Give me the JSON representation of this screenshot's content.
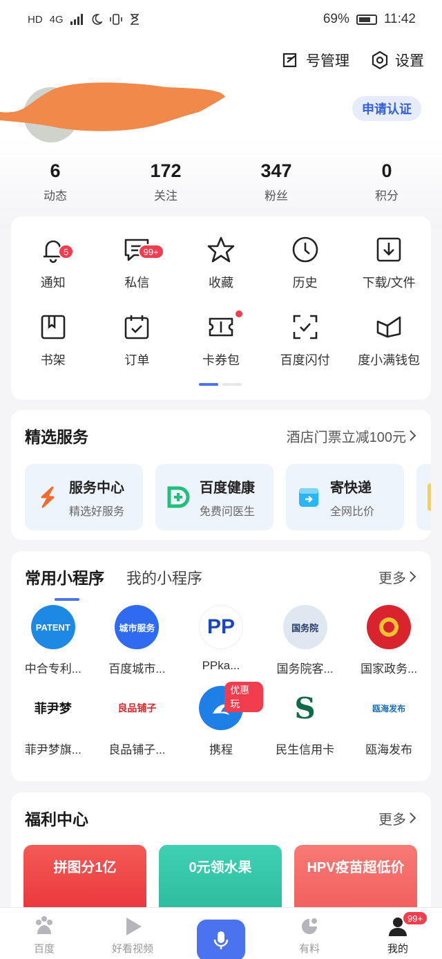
{
  "status_bar": {
    "left_icons": [
      "HD",
      "4G"
    ],
    "battery": "69%",
    "time": "11:42"
  },
  "header": {
    "account_manage": "号管理",
    "settings": "设置"
  },
  "profile": {
    "certify_button": "申请认证"
  },
  "stats": [
    {
      "num": "6",
      "label": "动态"
    },
    {
      "num": "172",
      "label": "关注"
    },
    {
      "num": "347",
      "label": "粉丝"
    },
    {
      "num": "0",
      "label": "积分"
    }
  ],
  "quick_grid": [
    {
      "label": "通知",
      "icon": "bell-icon",
      "badge": "5"
    },
    {
      "label": "私信",
      "icon": "message-icon",
      "badge": "99+"
    },
    {
      "label": "收藏",
      "icon": "star-icon"
    },
    {
      "label": "历史",
      "icon": "clock-icon"
    },
    {
      "label": "下载/文件",
      "icon": "download-icon"
    },
    {
      "label": "书架",
      "icon": "bookshelf-icon"
    },
    {
      "label": "订单",
      "icon": "order-icon"
    },
    {
      "label": "卡券包",
      "icon": "ticket-icon",
      "dot": true
    },
    {
      "label": "百度闪付",
      "icon": "scan-pay-icon"
    },
    {
      "label": "度小满钱包",
      "icon": "wallet-icon"
    }
  ],
  "services": {
    "title": "精选服务",
    "promo": "酒店门票立减100元",
    "items": [
      {
        "title": "服务中心",
        "sub": "精选好服务"
      },
      {
        "title": "百度健康",
        "sub": "免费问医生"
      },
      {
        "title": "寄快递",
        "sub": "全网比价"
      }
    ]
  },
  "mini_programs": {
    "tab_common": "常用小程序",
    "tab_mine": "我的小程序",
    "more": "更多",
    "items": [
      {
        "name": "中合专利...",
        "logo_text": "PATENT",
        "logo_bg": "#1e88e5"
      },
      {
        "name": "百度城市...",
        "logo_text": "城市服务",
        "logo_bg": "#2f6bf0"
      },
      {
        "name": "PPka...",
        "logo_text": "PP",
        "logo_bg": "#ffffff"
      },
      {
        "name": "国务院客...",
        "logo_text": "国务院",
        "logo_bg": "#dfe7f0"
      },
      {
        "name": "国家政务...",
        "logo_text": "",
        "logo_bg": "#d9232d"
      },
      {
        "name": "菲尹梦旗...",
        "logo_text": "菲尹梦",
        "logo_bg": "#ffffff"
      },
      {
        "name": "良品铺子...",
        "logo_text": "良品铺子",
        "logo_bg": "#ffffff"
      },
      {
        "name": "携程",
        "logo_text": "",
        "logo_bg": "#1e7fe6",
        "tag": "优惠玩"
      },
      {
        "name": "民生信用卡",
        "logo_text": "S",
        "logo_bg": "#ffffff"
      },
      {
        "name": "瓯海发布",
        "logo_text": "瓯海发布",
        "logo_bg": "#ffffff"
      }
    ]
  },
  "welfare": {
    "title": "福利中心",
    "more": "更多",
    "items": [
      {
        "title": "拼图分1亿",
        "bg": "#f04a4a"
      },
      {
        "title": "0元领水果",
        "bg": "#2fc7a5"
      },
      {
        "title": "HPV疫苗超低价",
        "bg": "#f46a6a"
      }
    ]
  },
  "bottom_nav": {
    "items": [
      {
        "label": "百度",
        "icon": "baidu-paw-icon"
      },
      {
        "label": "好看视频",
        "icon": "play-icon"
      },
      {
        "label": "",
        "icon": "mic-icon"
      },
      {
        "label": "有料",
        "icon": "youliao-icon"
      },
      {
        "label": "我的",
        "icon": "user-icon",
        "badge": "99+"
      }
    ]
  }
}
